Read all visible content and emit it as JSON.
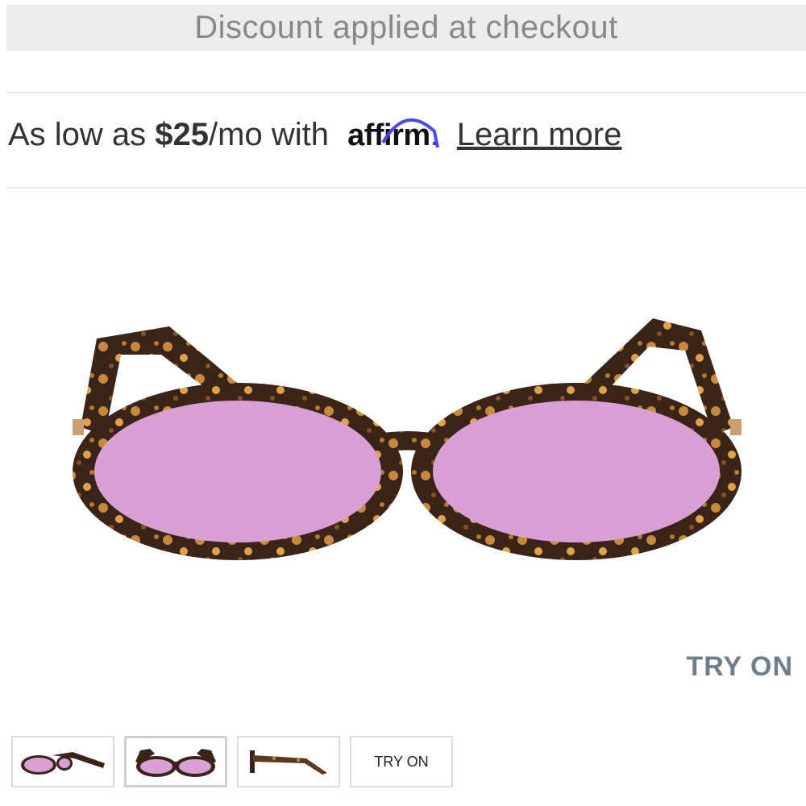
{
  "banner": {
    "text": "Discount applied at checkout"
  },
  "financing": {
    "prefix": "As low as ",
    "price": "$25",
    "suffix": "/mo with ",
    "brand": "affirm",
    "period": ".",
    "link": "Learn more"
  },
  "product_image": {
    "icon": "sunglasses-image",
    "lens_color": "#d8a0d4",
    "frame_color": "#3a2418"
  },
  "try_on": {
    "label": "TRY ON"
  },
  "thumbnails": [
    {
      "icon": "sunglasses-angle-thumbnail"
    },
    {
      "icon": "sunglasses-front-thumbnail",
      "selected": true
    },
    {
      "icon": "sunglasses-side-thumbnail"
    },
    {
      "label": "TRY ON"
    }
  ]
}
